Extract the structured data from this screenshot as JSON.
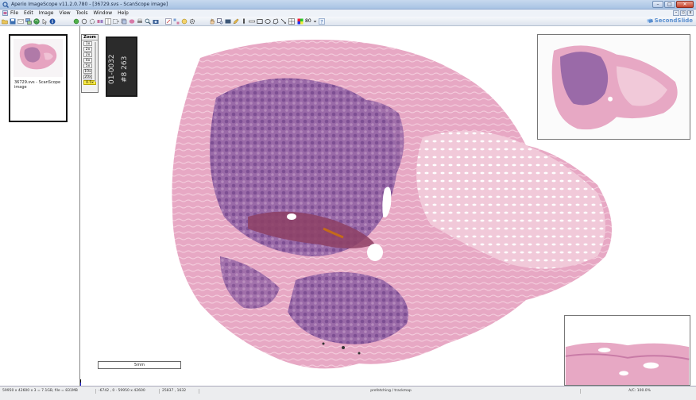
{
  "window": {
    "title": "Aperio ImageScope v11.2.0.780 - [36729.svs - ScanScope image]",
    "controls": {
      "minimize": "–",
      "maximize": "□",
      "close": "✕"
    }
  },
  "menu": {
    "items": [
      "File",
      "Edit",
      "Image",
      "View",
      "Tools",
      "Window",
      "Help"
    ],
    "mdi_controls": [
      "–",
      "▫",
      "x"
    ]
  },
  "toolbar": {
    "zoom_value": "80",
    "brand": "SecondSlide"
  },
  "thumbnail_panel": {
    "caption": "36729.svs - ScanScope image"
  },
  "zoom_panel": {
    "title": "Zoom",
    "levels": [
      "1x",
      "2x",
      "2x",
      "4x",
      "5x",
      "10x",
      "20x"
    ],
    "current": "0.5x"
  },
  "scale_bar": {
    "label": "5mm"
  },
  "status_bar": {
    "image_info": "59950 x 42600 x 3 = 7.1GB, file = 831MB",
    "coords": "-6742 , 0 · 59950 x 42600",
    "cursor": "25837 , 1632",
    "status_message": "prefetching / trackmap",
    "zoom_info": "A/C: 100.0%"
  },
  "colors": {
    "tissue_pink": "#e9a9c2",
    "tissue_purple": "#8a5d9e",
    "zoom_highlight": "#ffef4a",
    "titlebar": "#bcd2ee",
    "brand_blue": "#5a8fd0"
  }
}
